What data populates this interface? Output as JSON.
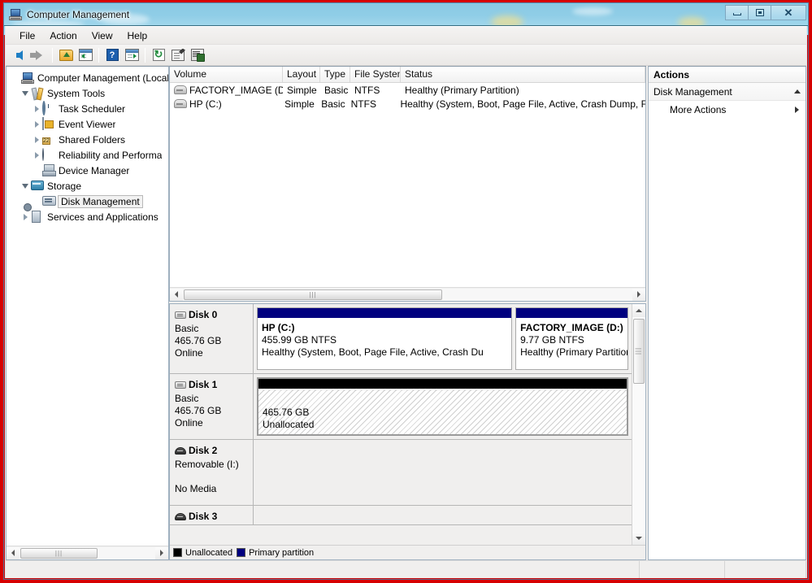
{
  "window": {
    "title": "Computer Management",
    "app_icon": "computer-management-icon",
    "buttons": {
      "minimize": "Minimize",
      "restore": "Restore",
      "close": "Close"
    }
  },
  "menubar": {
    "items": [
      "File",
      "Action",
      "View",
      "Help"
    ]
  },
  "toolbar": {
    "items": [
      {
        "name": "back-icon",
        "title": "Back"
      },
      {
        "name": "forward-icon",
        "title": "Forward"
      },
      {
        "name": "up-one-level-icon",
        "title": "Up One Level"
      },
      {
        "name": "show-hide-console-tree-icon",
        "title": "Show/Hide Console Tree"
      },
      {
        "name": "help-icon",
        "title": "Help"
      },
      {
        "name": "show-hide-action-pane-icon",
        "title": "Show/Hide Action Pane"
      },
      {
        "name": "refresh-icon",
        "title": "Refresh"
      },
      {
        "name": "properties-icon",
        "title": "Properties"
      },
      {
        "name": "export-list-icon",
        "title": "Export List"
      }
    ]
  },
  "tree": {
    "nodes": [
      {
        "label": "Computer Management (Local",
        "icon": "computer-management-icon",
        "indent": 0,
        "expander": "expanded",
        "selected": false
      },
      {
        "label": "System Tools",
        "icon": "system-tools-icon",
        "indent": 1,
        "expander": "expanded",
        "selected": false
      },
      {
        "label": "Task Scheduler",
        "icon": "task-scheduler-icon",
        "indent": 2,
        "expander": "collapsed",
        "selected": false
      },
      {
        "label": "Event Viewer",
        "icon": "event-viewer-icon",
        "indent": 2,
        "expander": "collapsed",
        "selected": false
      },
      {
        "label": "Shared Folders",
        "icon": "shared-folders-icon",
        "indent": 2,
        "expander": "collapsed",
        "selected": false
      },
      {
        "label": "Reliability and Performa",
        "icon": "reliability-performance-icon",
        "indent": 2,
        "expander": "collapsed",
        "selected": false
      },
      {
        "label": "Device Manager",
        "icon": "device-manager-icon",
        "indent": 2,
        "expander": "none",
        "selected": false
      },
      {
        "label": "Storage",
        "icon": "storage-icon",
        "indent": 1,
        "expander": "expanded",
        "selected": false
      },
      {
        "label": "Disk Management",
        "icon": "disk-management-icon",
        "indent": 2,
        "expander": "none",
        "selected": true
      },
      {
        "label": "Services and Applications",
        "icon": "services-applications-icon",
        "indent": 1,
        "expander": "collapsed",
        "selected": false
      }
    ]
  },
  "volume_list": {
    "columns": [
      "Volume",
      "Layout",
      "Type",
      "File System",
      "Status"
    ],
    "rows": [
      {
        "volume": "FACTORY_IMAGE (D:)",
        "layout": "Simple",
        "type": "Basic",
        "file_system": "NTFS",
        "status": "Healthy (Primary Partition)"
      },
      {
        "volume": "HP (C:)",
        "layout": "Simple",
        "type": "Basic",
        "file_system": "NTFS",
        "status": "Healthy (System, Boot, Page File, Active, Crash Dump, F"
      }
    ]
  },
  "disk_view": {
    "disks": [
      {
        "name": "Disk 0",
        "icon": "hard-disk-icon",
        "lines": [
          "Basic",
          "465.76 GB",
          "Online"
        ],
        "partitions": [
          {
            "kind": "primary",
            "name": "HP  (C:)",
            "size": "455.99 GB NTFS",
            "status": "Healthy (System, Boot, Page File, Active, Crash Du",
            "flex": 455.99
          },
          {
            "kind": "primary",
            "name": "FACTORY_IMAGE  (D:)",
            "size": "9.77 GB NTFS",
            "status": "Healthy (Primary Partition)",
            "flex": 200
          }
        ]
      },
      {
        "name": "Disk 1",
        "icon": "hard-disk-icon",
        "lines": [
          "Basic",
          "465.76 GB",
          "Online"
        ],
        "partitions": [
          {
            "kind": "unallocated",
            "name": "",
            "size": "465.76 GB",
            "status": "Unallocated",
            "flex": 100
          }
        ]
      },
      {
        "name": "Disk 2",
        "icon": "removable-disk-icon",
        "lines": [
          "Removable (I:)",
          "",
          "No Media"
        ],
        "partitions": [
          {
            "kind": "empty",
            "name": "",
            "size": "",
            "status": "",
            "flex": 100
          }
        ]
      },
      {
        "name": "Disk 3",
        "icon": "removable-disk-icon",
        "lines": [],
        "partitions": [
          {
            "kind": "empty",
            "name": "",
            "size": "",
            "status": "",
            "flex": 100
          }
        ]
      }
    ],
    "legend": [
      {
        "label": "Unallocated",
        "color": "#000000"
      },
      {
        "label": "Primary partition",
        "color": "#00007f"
      }
    ]
  },
  "actions": {
    "header": "Actions",
    "group": {
      "label": "Disk Management",
      "chevron": "chevron-up-icon"
    },
    "items": [
      {
        "label": "More Actions",
        "chevron": "chevron-right-icon"
      }
    ]
  },
  "colors": {
    "primary_partition": "#00007f",
    "unallocated": "#000000",
    "window_border": "#4682aa",
    "annotation_frame": "#d60000",
    "selection": "#f2f2f2"
  }
}
